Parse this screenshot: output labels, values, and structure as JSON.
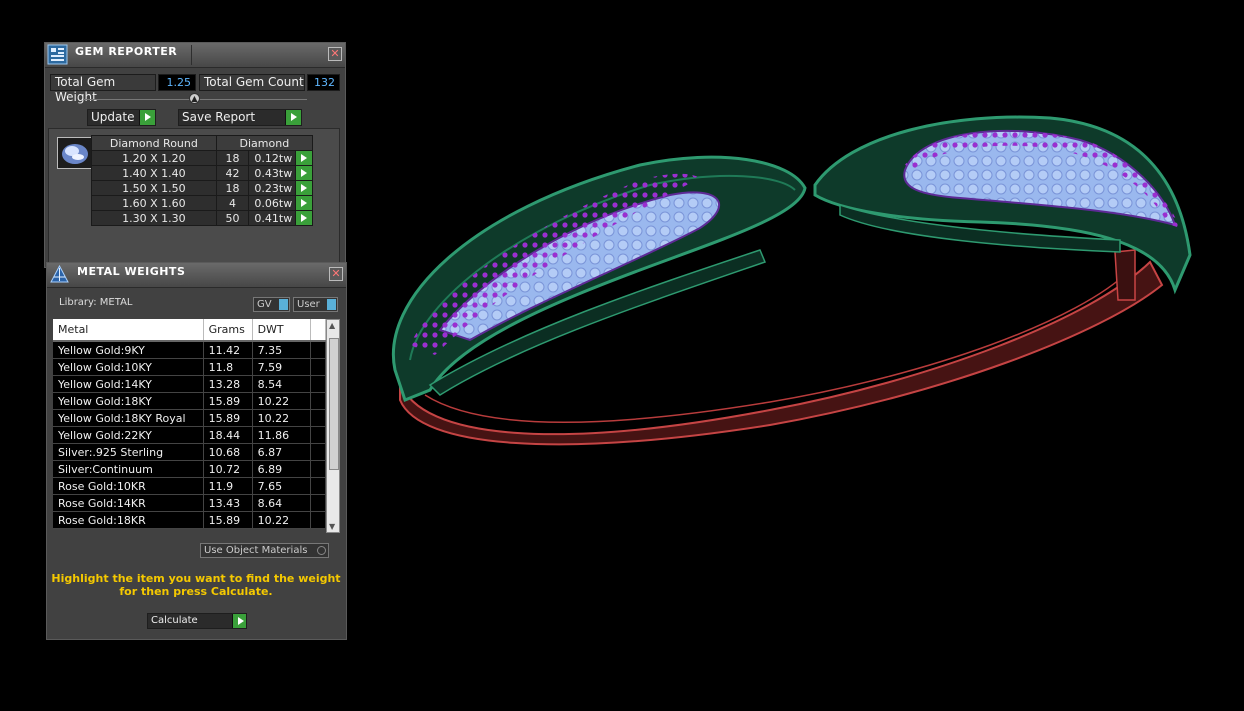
{
  "gem_reporter": {
    "title": "GEM REPORTER",
    "total_gem_weight_label": "Total Gem Weight",
    "total_gem_weight": "1.25",
    "total_gem_count_label": "Total Gem Count",
    "total_gem_count": "132",
    "update_label": "Update",
    "save_report_label": "Save Report",
    "table": {
      "headers": [
        "Diamond Round",
        "Diamond"
      ],
      "rows": [
        {
          "size": "1.20 X 1.20",
          "count": "18",
          "weight": "0.12tw"
        },
        {
          "size": "1.40 X 1.40",
          "count": "42",
          "weight": "0.43tw"
        },
        {
          "size": "1.50 X 1.50",
          "count": "18",
          "weight": "0.23tw"
        },
        {
          "size": "1.60 X 1.60",
          "count": "4",
          "weight": "0.06tw"
        },
        {
          "size": "1.30 X 1.30",
          "count": "50",
          "weight": "0.41tw"
        }
      ]
    }
  },
  "metal_weights": {
    "title": "METAL WEIGHTS",
    "library": "Library: METAL",
    "gv_label": "GV",
    "user_label": "User",
    "columns": [
      "Metal",
      "Grams",
      "DWT"
    ],
    "rows": [
      {
        "metal": "Yellow Gold:9KY",
        "grams": "11.42",
        "dwt": "7.35"
      },
      {
        "metal": "Yellow Gold:10KY",
        "grams": "11.8",
        "dwt": "7.59"
      },
      {
        "metal": "Yellow Gold:14KY",
        "grams": "13.28",
        "dwt": "8.54"
      },
      {
        "metal": "Yellow Gold:18KY",
        "grams": "15.89",
        "dwt": "10.22"
      },
      {
        "metal": "Yellow Gold:18KY Royal",
        "grams": "15.89",
        "dwt": "10.22"
      },
      {
        "metal": "Yellow Gold:22KY",
        "grams": "18.44",
        "dwt": "11.86"
      },
      {
        "metal": "Silver:.925 Sterling",
        "grams": "10.68",
        "dwt": "6.87"
      },
      {
        "metal": "Silver:Continuum",
        "grams": "10.72",
        "dwt": "6.89"
      },
      {
        "metal": "Rose Gold:10KR",
        "grams": "11.9",
        "dwt": "7.65"
      },
      {
        "metal": "Rose Gold:14KR",
        "grams": "13.43",
        "dwt": "8.64"
      },
      {
        "metal": "Rose Gold:18KR",
        "grams": "15.89",
        "dwt": "10.22"
      }
    ],
    "use_object_materials": "Use Object Materials",
    "hint_line1": "Highlight the item you want to find the weight",
    "hint_line2": "for then press Calculate.",
    "calculate_label": "Calculate"
  }
}
